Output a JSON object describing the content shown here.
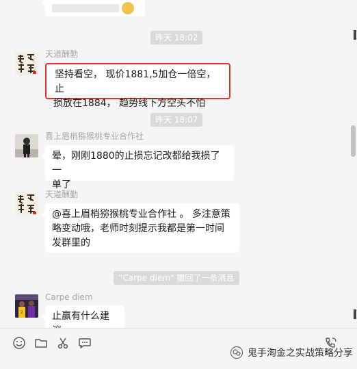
{
  "messages": {
    "top_partial_text": "…"
  },
  "timestamps": [
    "昨天 18:02",
    "昨天 18:07"
  ],
  "message_1": {
    "sender": "天道酬勤",
    "lines": [
      "坚持看空， 现价1881,5加仓一倍空， 止",
      "损放在1884， 趋势线下方空头不怕"
    ]
  },
  "message_2": {
    "sender": "喜上眉梢猕猴桃专业合作社",
    "lines": [
      "晕，刚刚1880的止损忘记改都给我损了一",
      "单了"
    ]
  },
  "message_3": {
    "sender": "天道酬勤",
    "lines": [
      "@喜上眉梢猕猴桃专业合作社 。 多注意策",
      "略变动哦，老师时刻提示我都是第一时间",
      "发群里的"
    ]
  },
  "recall_notice": "\"Carpe diem\" 撤回了一条消息",
  "message_4": {
    "sender": "Carpe diem",
    "lines": [
      "止赢有什么建议"
    ]
  },
  "watermark": "鬼手淘金之实战策略分享",
  "colors": {
    "highlight_border": "#e0312c",
    "background": "#f5f5f5",
    "bubble": "#ffffff"
  }
}
